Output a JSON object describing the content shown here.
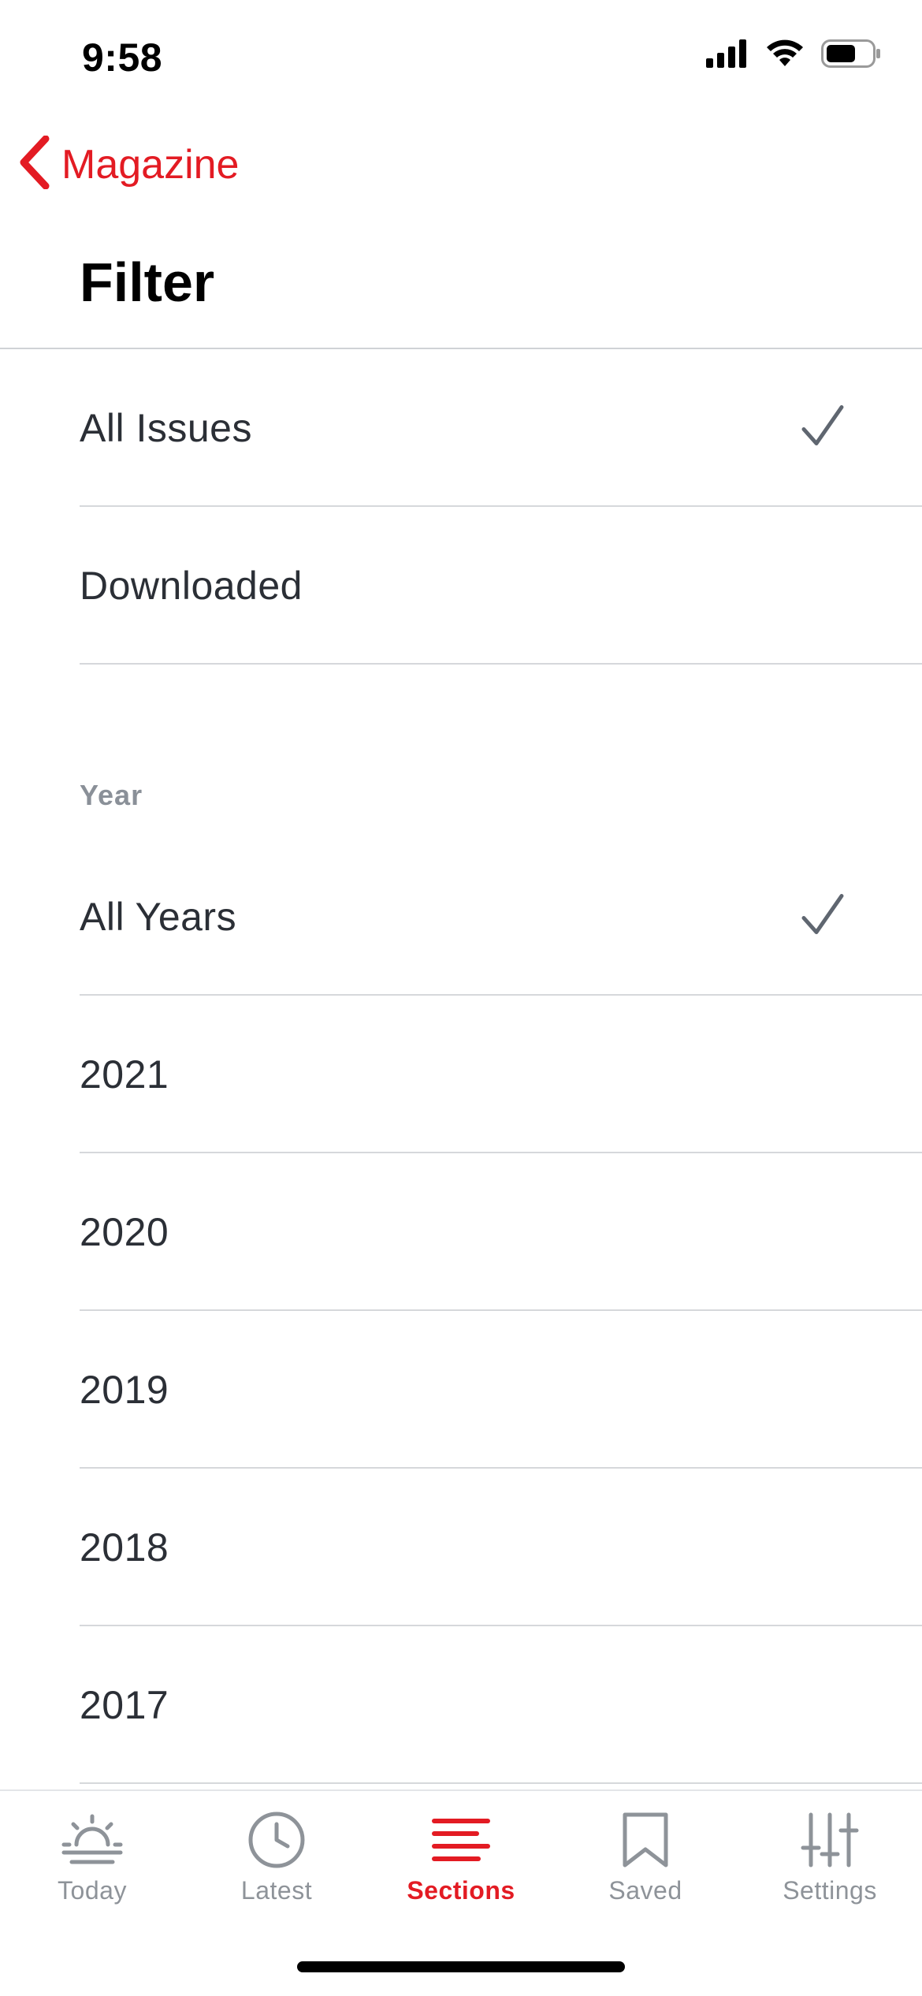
{
  "status_bar": {
    "time": "9:58",
    "icons": [
      "cellular-signal-icon",
      "wifi-icon",
      "battery-icon"
    ]
  },
  "nav": {
    "back_label": "Magazine",
    "title": "Filter"
  },
  "issue_filter": {
    "items": [
      {
        "label": "All Issues",
        "selected": true
      },
      {
        "label": "Downloaded",
        "selected": false
      }
    ]
  },
  "year_filter": {
    "header": "Year",
    "items": [
      {
        "label": "All Years",
        "selected": true
      },
      {
        "label": "2021",
        "selected": false
      },
      {
        "label": "2020",
        "selected": false
      },
      {
        "label": "2019",
        "selected": false
      },
      {
        "label": "2018",
        "selected": false
      },
      {
        "label": "2017",
        "selected": false
      }
    ]
  },
  "tab_bar": {
    "active": "Sections",
    "tabs": [
      {
        "label": "Today",
        "icon": "sunrise-icon"
      },
      {
        "label": "Latest",
        "icon": "clock-icon"
      },
      {
        "label": "Sections",
        "icon": "menu-lines-icon"
      },
      {
        "label": "Saved",
        "icon": "bookmark-icon"
      },
      {
        "label": "Settings",
        "icon": "sliders-icon"
      }
    ]
  },
  "colors": {
    "accent": "#e31b23",
    "text": "#2b2f36",
    "secondary_text": "#8a9098",
    "checkmark": "#5f6670",
    "divider": "#d6d8db",
    "tab_inactive": "#8e9399"
  }
}
